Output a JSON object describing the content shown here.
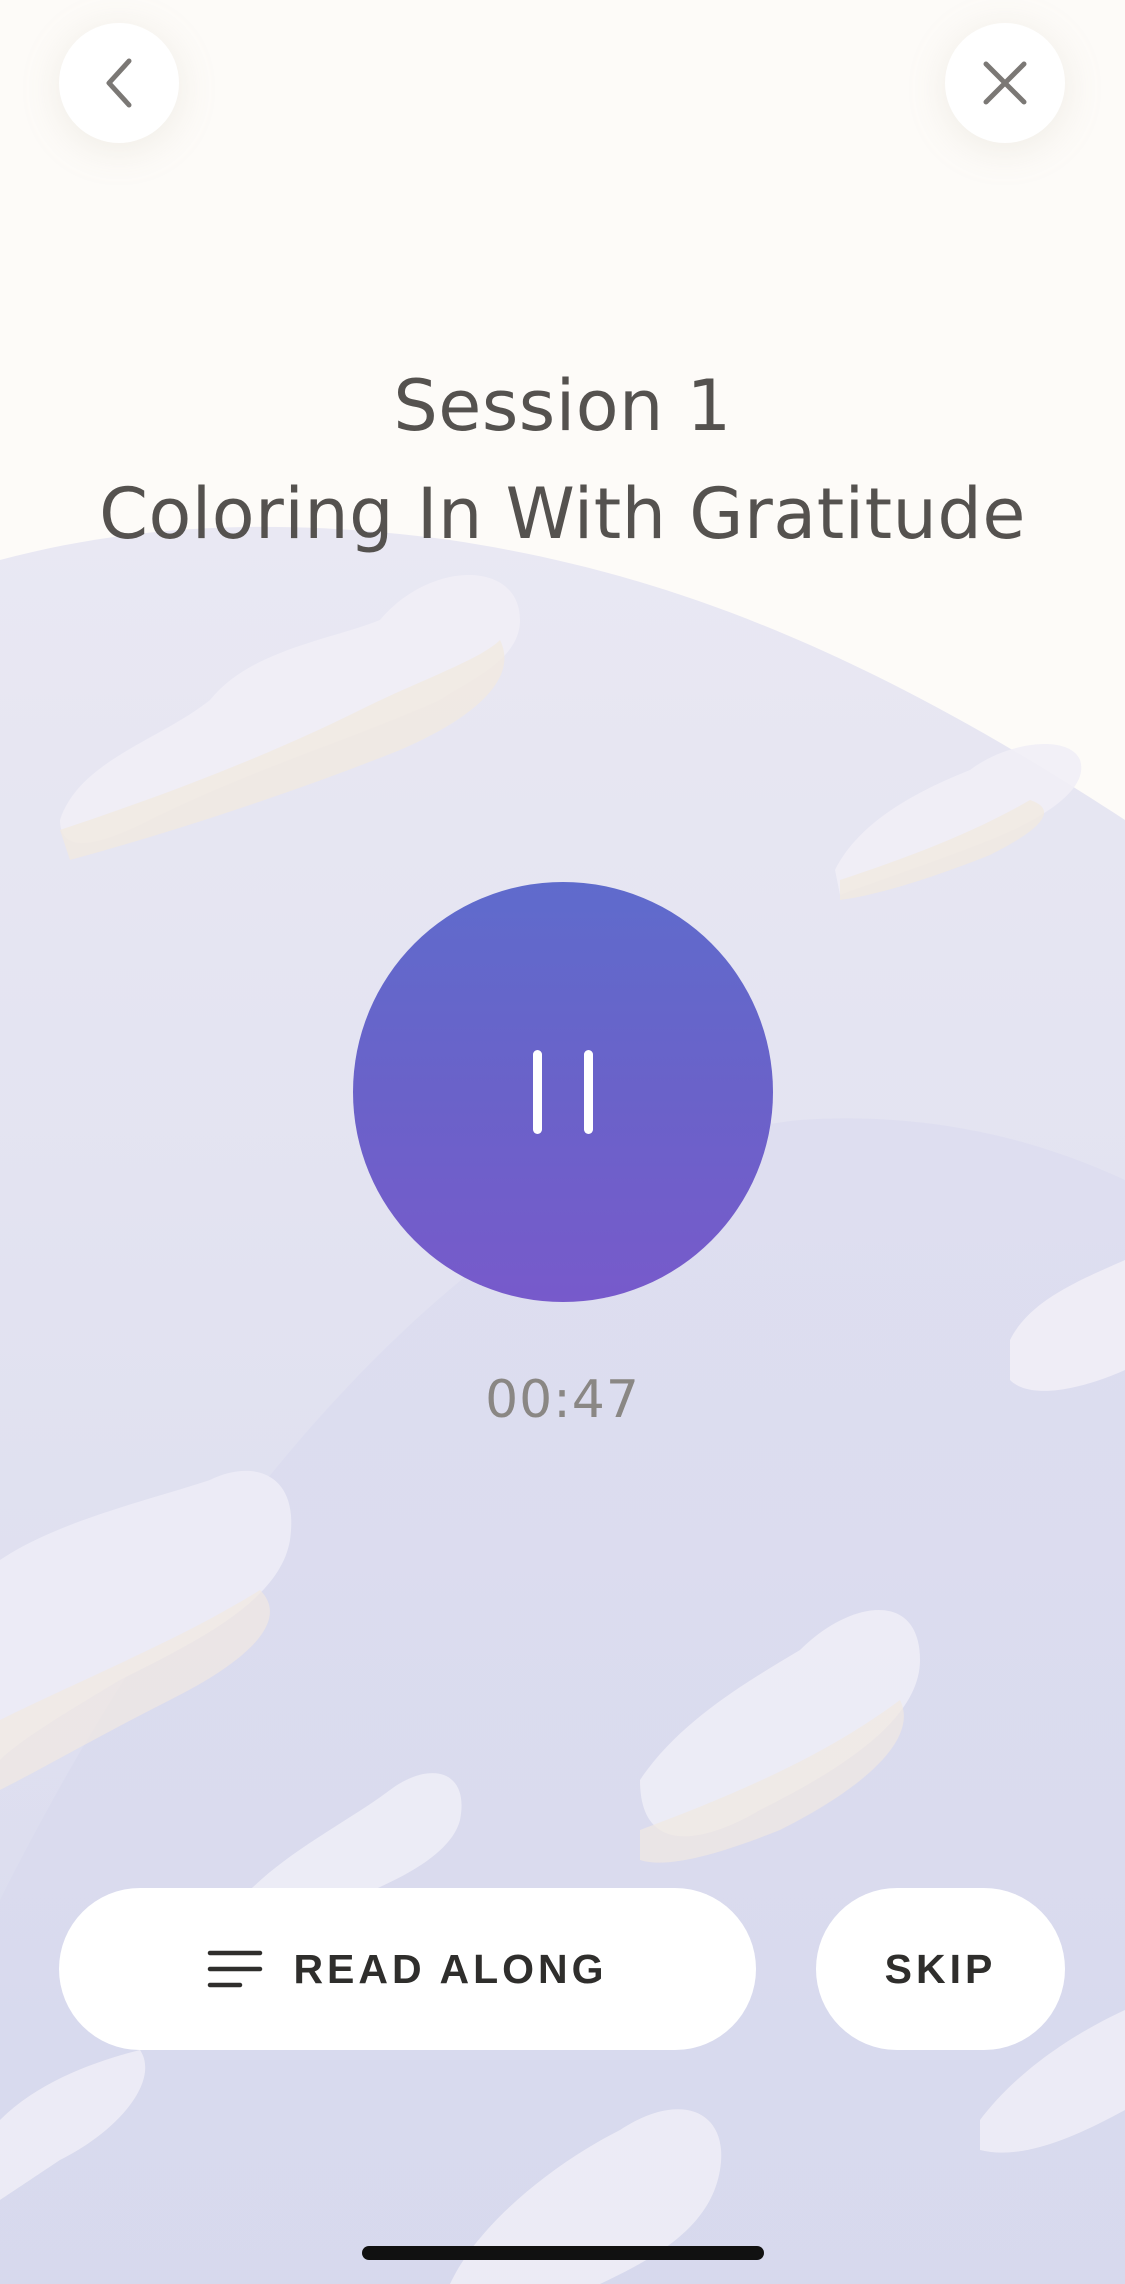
{
  "header": {
    "back_icon": "chevron-left-icon",
    "close_icon": "close-icon"
  },
  "session": {
    "label": "Session 1",
    "title": "Coloring In With Gratitude"
  },
  "player": {
    "state_icon": "pause-icon",
    "elapsed": "00:47",
    "button_color_top": "#5f6bcc",
    "button_color_bottom": "#775acb"
  },
  "actions": {
    "read_along_icon": "menu-lines-icon",
    "read_along_label": "READ ALONG",
    "skip_label": "SKIP"
  }
}
